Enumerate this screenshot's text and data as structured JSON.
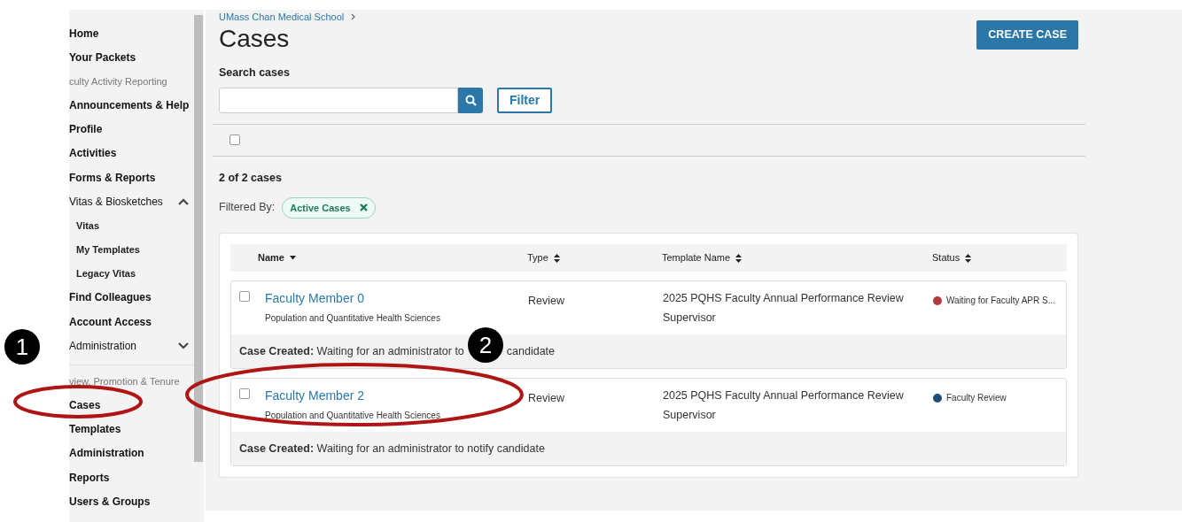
{
  "sidebar": {
    "items": [
      {
        "kind": "link",
        "label": "Home"
      },
      {
        "kind": "link",
        "label": "Your Packets"
      },
      {
        "kind": "section",
        "label": "culty Activity Reporting"
      },
      {
        "kind": "link",
        "label": "Announcements & Help"
      },
      {
        "kind": "link",
        "label": "Profile"
      },
      {
        "kind": "link",
        "label": "Activities"
      },
      {
        "kind": "link",
        "label": "Forms & Reports"
      },
      {
        "kind": "group",
        "label": "Vitas & Biosketches",
        "expanded": true,
        "children": [
          {
            "label": "Vitas"
          },
          {
            "label": "My Templates"
          },
          {
            "label": "Legacy Vitas"
          }
        ]
      },
      {
        "kind": "link",
        "label": "Find Colleagues"
      },
      {
        "kind": "link",
        "label": "Account Access"
      },
      {
        "kind": "group",
        "label": "Administration",
        "expanded": false
      },
      {
        "kind": "divider"
      },
      {
        "kind": "section",
        "label": "view, Promotion & Tenure"
      },
      {
        "kind": "link",
        "label": "Cases"
      },
      {
        "kind": "link",
        "label": "Templates"
      },
      {
        "kind": "link",
        "label": "Administration"
      },
      {
        "kind": "link",
        "label": "Reports"
      },
      {
        "kind": "link",
        "label": "Users & Groups"
      }
    ]
  },
  "breadcrumb": [
    "UMass Chan Medical School"
  ],
  "title": "Cases",
  "create_button": "CREATE CASE",
  "search": {
    "label": "Search cases"
  },
  "filter_button": "Filter",
  "select_all": {
    "checked": false
  },
  "count": "2 of 2 cases",
  "filtered_by": {
    "label": "Filtered By:",
    "chips": [
      "Active Cases"
    ]
  },
  "table": {
    "columns": [
      {
        "label": "Name",
        "sorted": true
      },
      {
        "label": "Type",
        "sorted": false
      },
      {
        "label": "Template Name",
        "sorted": false
      },
      {
        "label": "Status",
        "sorted": false
      }
    ],
    "rows": [
      {
        "checked": false,
        "name": "Faculty Member 0",
        "department": "Population and Quantitative Health Sciences",
        "type": "Review",
        "template": "2025 PQHS Faculty Annual Performance Review Supervisor",
        "status": "Waiting for Faculty APR S...",
        "color": "#b33a3a",
        "note_label": "Case Created:",
        "note": "Waiting for an administrator to",
        "note_after": "candidate"
      },
      {
        "checked": false,
        "name": "Faculty Member 2",
        "department": "Population and Quantitative Health Sciences",
        "type": "Review",
        "template": "2025 PQHS Faculty Annual Performance Review Supervisor",
        "status": "Faculty Review",
        "color": "#1f4e79",
        "note_label": "Case Created:",
        "note": "Waiting for an administrator to notify candidate"
      }
    ]
  },
  "callouts": [
    {
      "label": "1"
    },
    {
      "label": "2"
    }
  ]
}
